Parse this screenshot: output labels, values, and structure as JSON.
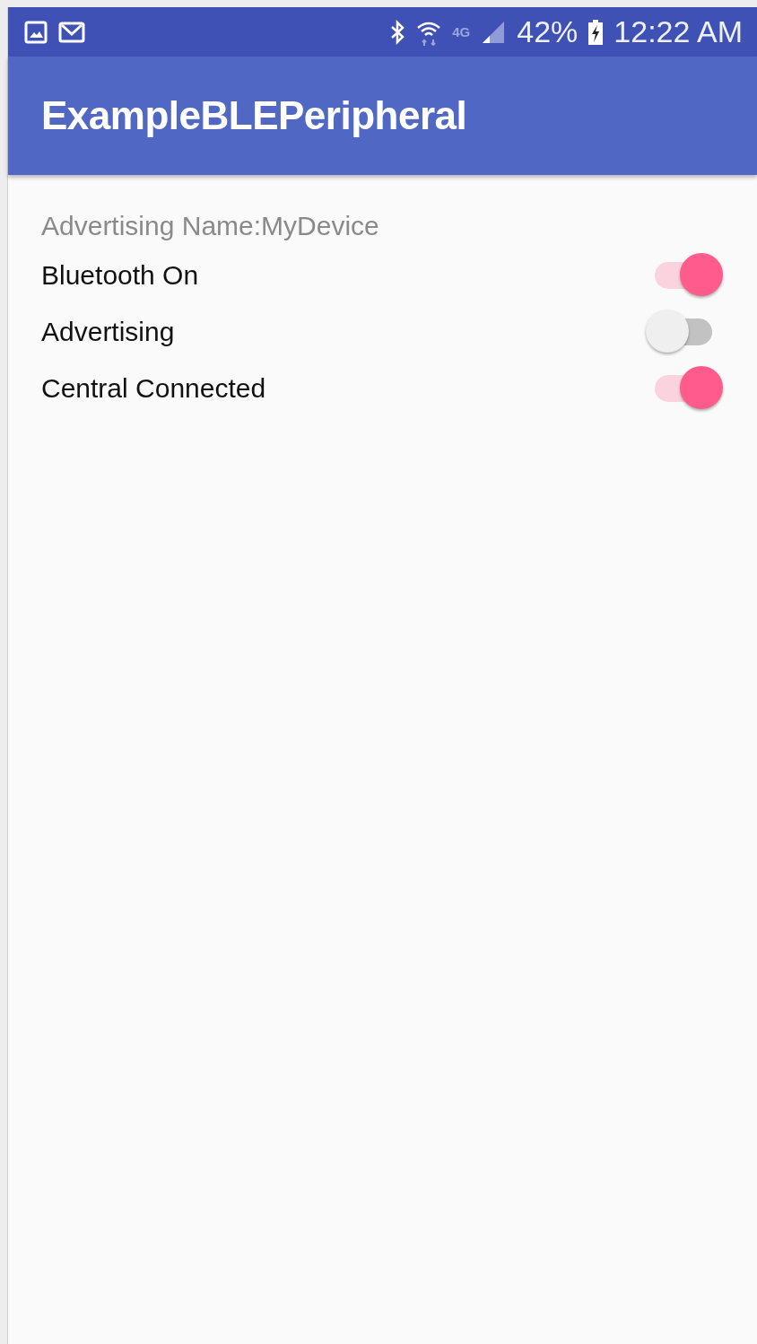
{
  "status_bar": {
    "network": "4G",
    "battery": "42%",
    "time": "12:22 AM"
  },
  "app_bar": {
    "title": "ExampleBLEPeripheral"
  },
  "advertising_name": "Advertising Name:MyDevice",
  "toggles": [
    {
      "label": "Bluetooth On",
      "on": true
    },
    {
      "label": "Advertising",
      "on": false
    },
    {
      "label": "Central Connected",
      "on": true
    }
  ]
}
